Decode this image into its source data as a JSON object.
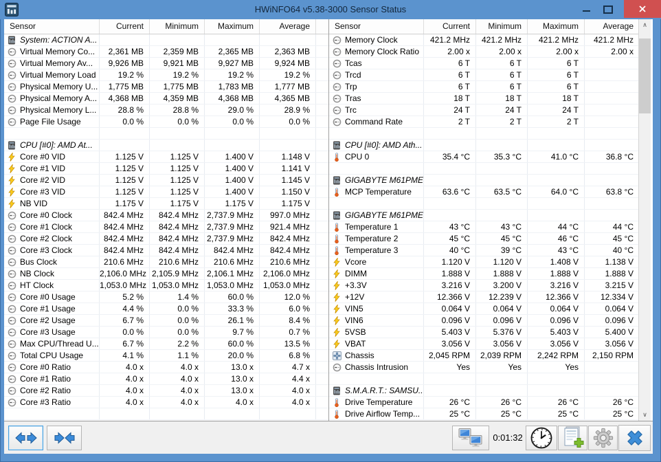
{
  "window": {
    "title": "HWiNFO64 v5.38-3000 Sensor Status",
    "app_icon": "hwinfo-logo-icon",
    "controls": [
      "minimize",
      "maximize",
      "close"
    ]
  },
  "colors": {
    "titlebar_blue": "#5b93ce",
    "close_button_red": "#d05050",
    "toolbar_arrow_blue": "#3c8bd9",
    "bolt_yellow": "#ffd21e",
    "thermometer_orange": "#e85f1e",
    "plus_green": "#7dbd2e"
  },
  "table": {
    "columns": [
      "Sensor",
      "Current",
      "Minimum",
      "Maximum",
      "Average"
    ],
    "left_rows": [
      {
        "type": "section",
        "icon": "chip-icon",
        "label": "System: ACTION A..."
      },
      {
        "type": "sensor",
        "icon": "gauge-icon",
        "label": "Virtual Memory Co...",
        "values": [
          "2,361 MB",
          "2,359 MB",
          "2,365 MB",
          "2,363 MB"
        ]
      },
      {
        "type": "sensor",
        "icon": "gauge-icon",
        "label": "Virtual Memory Av...",
        "values": [
          "9,926 MB",
          "9,921 MB",
          "9,927 MB",
          "9,924 MB"
        ]
      },
      {
        "type": "sensor",
        "icon": "gauge-icon",
        "label": "Virtual Memory Load",
        "values": [
          "19.2 %",
          "19.2 %",
          "19.2 %",
          "19.2 %"
        ]
      },
      {
        "type": "sensor",
        "icon": "gauge-icon",
        "label": "Physical Memory U...",
        "values": [
          "1,775 MB",
          "1,775 MB",
          "1,783 MB",
          "1,777 MB"
        ]
      },
      {
        "type": "sensor",
        "icon": "gauge-icon",
        "label": "Physical Memory A...",
        "values": [
          "4,368 MB",
          "4,359 MB",
          "4,368 MB",
          "4,365 MB"
        ]
      },
      {
        "type": "sensor",
        "icon": "gauge-icon",
        "label": "Physical Memory L...",
        "values": [
          "28.8 %",
          "28.8 %",
          "29.0 %",
          "28.9 %"
        ]
      },
      {
        "type": "sensor",
        "icon": "gauge-icon",
        "label": "Page File Usage",
        "values": [
          "0.0 %",
          "0.0 %",
          "0.0 %",
          "0.0 %"
        ]
      },
      {
        "type": "empty"
      },
      {
        "type": "section",
        "icon": "chip-icon",
        "label": "CPU [#0]: AMD At..."
      },
      {
        "type": "sensor",
        "icon": "bolt-icon",
        "label": "Core #0 VID",
        "values": [
          "1.125 V",
          "1.125 V",
          "1.400 V",
          "1.148 V"
        ]
      },
      {
        "type": "sensor",
        "icon": "bolt-icon",
        "label": "Core #1 VID",
        "values": [
          "1.125 V",
          "1.125 V",
          "1.400 V",
          "1.141 V"
        ]
      },
      {
        "type": "sensor",
        "icon": "bolt-icon",
        "label": "Core #2 VID",
        "values": [
          "1.125 V",
          "1.125 V",
          "1.400 V",
          "1.145 V"
        ]
      },
      {
        "type": "sensor",
        "icon": "bolt-icon",
        "label": "Core #3 VID",
        "values": [
          "1.125 V",
          "1.125 V",
          "1.400 V",
          "1.150 V"
        ]
      },
      {
        "type": "sensor",
        "icon": "bolt-icon",
        "label": "NB VID",
        "values": [
          "1.175 V",
          "1.175 V",
          "1.175 V",
          "1.175 V"
        ]
      },
      {
        "type": "sensor",
        "icon": "gauge-icon",
        "label": "Core #0 Clock",
        "values": [
          "842.4 MHz",
          "842.4 MHz",
          "2,737.9 MHz",
          "997.0 MHz"
        ]
      },
      {
        "type": "sensor",
        "icon": "gauge-icon",
        "label": "Core #1 Clock",
        "values": [
          "842.4 MHz",
          "842.4 MHz",
          "2,737.9 MHz",
          "921.4 MHz"
        ]
      },
      {
        "type": "sensor",
        "icon": "gauge-icon",
        "label": "Core #2 Clock",
        "values": [
          "842.4 MHz",
          "842.4 MHz",
          "2,737.9 MHz",
          "842.4 MHz"
        ]
      },
      {
        "type": "sensor",
        "icon": "gauge-icon",
        "label": "Core #3 Clock",
        "values": [
          "842.4 MHz",
          "842.4 MHz",
          "842.4 MHz",
          "842.4 MHz"
        ]
      },
      {
        "type": "sensor",
        "icon": "gauge-icon",
        "label": "Bus Clock",
        "values": [
          "210.6 MHz",
          "210.6 MHz",
          "210.6 MHz",
          "210.6 MHz"
        ]
      },
      {
        "type": "sensor",
        "icon": "gauge-icon",
        "label": "NB Clock",
        "values": [
          "2,106.0 MHz",
          "2,105.9 MHz",
          "2,106.1 MHz",
          "2,106.0 MHz"
        ]
      },
      {
        "type": "sensor",
        "icon": "gauge-icon",
        "label": "HT Clock",
        "values": [
          "1,053.0 MHz",
          "1,053.0 MHz",
          "1,053.0 MHz",
          "1,053.0 MHz"
        ]
      },
      {
        "type": "sensor",
        "icon": "gauge-icon",
        "label": "Core #0 Usage",
        "values": [
          "5.2 %",
          "1.4 %",
          "60.0 %",
          "12.0 %"
        ]
      },
      {
        "type": "sensor",
        "icon": "gauge-icon",
        "label": "Core #1 Usage",
        "values": [
          "4.4 %",
          "0.0 %",
          "33.3 %",
          "6.0 %"
        ]
      },
      {
        "type": "sensor",
        "icon": "gauge-icon",
        "label": "Core #2 Usage",
        "values": [
          "6.7 %",
          "0.0 %",
          "26.1 %",
          "8.4 %"
        ]
      },
      {
        "type": "sensor",
        "icon": "gauge-icon",
        "label": "Core #3 Usage",
        "values": [
          "0.0 %",
          "0.0 %",
          "9.7 %",
          "0.7 %"
        ]
      },
      {
        "type": "sensor",
        "icon": "gauge-icon",
        "label": "Max CPU/Thread U...",
        "values": [
          "6.7 %",
          "2.2 %",
          "60.0 %",
          "13.5 %"
        ]
      },
      {
        "type": "sensor",
        "icon": "gauge-icon",
        "label": "Total CPU Usage",
        "values": [
          "4.1 %",
          "1.1 %",
          "20.0 %",
          "6.8 %"
        ]
      },
      {
        "type": "sensor",
        "icon": "gauge-icon",
        "label": "Core #0 Ratio",
        "values": [
          "4.0 x",
          "4.0 x",
          "13.0 x",
          "4.7 x"
        ]
      },
      {
        "type": "sensor",
        "icon": "gauge-icon",
        "label": "Core #1 Ratio",
        "values": [
          "4.0 x",
          "4.0 x",
          "13.0 x",
          "4.4 x"
        ]
      },
      {
        "type": "sensor",
        "icon": "gauge-icon",
        "label": "Core #2 Ratio",
        "values": [
          "4.0 x",
          "4.0 x",
          "13.0 x",
          "4.0 x"
        ]
      },
      {
        "type": "sensor",
        "icon": "gauge-icon",
        "label": "Core #3 Ratio",
        "values": [
          "4.0 x",
          "4.0 x",
          "4.0 x",
          "4.0 x"
        ]
      },
      {
        "type": "empty"
      }
    ],
    "right_rows": [
      {
        "type": "sensor",
        "icon": "gauge-icon",
        "label": "Memory Clock",
        "values": [
          "421.2 MHz",
          "421.2 MHz",
          "421.2 MHz",
          "421.2 MHz"
        ]
      },
      {
        "type": "sensor",
        "icon": "gauge-icon",
        "label": "Memory Clock Ratio",
        "values": [
          "2.00 x",
          "2.00 x",
          "2.00 x",
          "2.00 x"
        ]
      },
      {
        "type": "sensor",
        "icon": "gauge-icon",
        "label": "Tcas",
        "values": [
          "6 T",
          "6 T",
          "6 T",
          ""
        ]
      },
      {
        "type": "sensor",
        "icon": "gauge-icon",
        "label": "Trcd",
        "values": [
          "6 T",
          "6 T",
          "6 T",
          ""
        ]
      },
      {
        "type": "sensor",
        "icon": "gauge-icon",
        "label": "Trp",
        "values": [
          "6 T",
          "6 T",
          "6 T",
          ""
        ]
      },
      {
        "type": "sensor",
        "icon": "gauge-icon",
        "label": "Tras",
        "values": [
          "18 T",
          "18 T",
          "18 T",
          ""
        ]
      },
      {
        "type": "sensor",
        "icon": "gauge-icon",
        "label": "Trc",
        "values": [
          "24 T",
          "24 T",
          "24 T",
          ""
        ]
      },
      {
        "type": "sensor",
        "icon": "gauge-icon",
        "label": "Command Rate",
        "values": [
          "2 T",
          "2 T",
          "2 T",
          ""
        ]
      },
      {
        "type": "empty"
      },
      {
        "type": "section",
        "icon": "chip-icon",
        "label": "CPU [#0]: AMD Ath..."
      },
      {
        "type": "sensor",
        "icon": "thermometer-icon",
        "label": "CPU 0",
        "values": [
          "35.4 °C",
          "35.3 °C",
          "41.0 °C",
          "36.8 °C"
        ]
      },
      {
        "type": "empty"
      },
      {
        "type": "section",
        "icon": "chip-icon",
        "label": "GIGABYTE M61PME..."
      },
      {
        "type": "sensor",
        "icon": "thermometer-icon",
        "label": "MCP Temperature",
        "values": [
          "63.6 °C",
          "63.5 °C",
          "64.0 °C",
          "63.8 °C"
        ]
      },
      {
        "type": "empty"
      },
      {
        "type": "section",
        "icon": "chip-icon",
        "label": "GIGABYTE M61PME..."
      },
      {
        "type": "sensor",
        "icon": "thermometer-icon",
        "label": "Temperature 1",
        "values": [
          "43 °C",
          "43 °C",
          "44 °C",
          "44 °C"
        ]
      },
      {
        "type": "sensor",
        "icon": "thermometer-icon",
        "label": "Temperature 2",
        "values": [
          "45 °C",
          "45 °C",
          "46 °C",
          "45 °C"
        ]
      },
      {
        "type": "sensor",
        "icon": "thermometer-icon",
        "label": "Temperature 3",
        "values": [
          "40 °C",
          "39 °C",
          "43 °C",
          "40 °C"
        ]
      },
      {
        "type": "sensor",
        "icon": "bolt-icon",
        "label": "Vcore",
        "values": [
          "1.120 V",
          "1.120 V",
          "1.408 V",
          "1.138 V"
        ]
      },
      {
        "type": "sensor",
        "icon": "bolt-icon",
        "label": "DIMM",
        "values": [
          "1.888 V",
          "1.888 V",
          "1.888 V",
          "1.888 V"
        ]
      },
      {
        "type": "sensor",
        "icon": "bolt-icon",
        "label": "+3.3V",
        "values": [
          "3.216 V",
          "3.200 V",
          "3.216 V",
          "3.215 V"
        ]
      },
      {
        "type": "sensor",
        "icon": "bolt-icon",
        "label": "+12V",
        "values": [
          "12.366 V",
          "12.239 V",
          "12.366 V",
          "12.334 V"
        ]
      },
      {
        "type": "sensor",
        "icon": "bolt-icon",
        "label": "VIN5",
        "values": [
          "0.064 V",
          "0.064 V",
          "0.064 V",
          "0.064 V"
        ]
      },
      {
        "type": "sensor",
        "icon": "bolt-icon",
        "label": "VIN6",
        "values": [
          "0.096 V",
          "0.096 V",
          "0.096 V",
          "0.096 V"
        ]
      },
      {
        "type": "sensor",
        "icon": "bolt-icon",
        "label": "5VSB",
        "values": [
          "5.403 V",
          "5.376 V",
          "5.403 V",
          "5.400 V"
        ]
      },
      {
        "type": "sensor",
        "icon": "bolt-icon",
        "label": "VBAT",
        "values": [
          "3.056 V",
          "3.056 V",
          "3.056 V",
          "3.056 V"
        ]
      },
      {
        "type": "sensor",
        "icon": "fan-icon",
        "label": "Chassis",
        "values": [
          "2,045 RPM",
          "2,039 RPM",
          "2,242 RPM",
          "2,150 RPM"
        ]
      },
      {
        "type": "sensor",
        "icon": "gauge-icon",
        "label": "Chassis Intrusion",
        "values": [
          "Yes",
          "Yes",
          "Yes",
          ""
        ]
      },
      {
        "type": "empty"
      },
      {
        "type": "section",
        "icon": "chip-icon",
        "label": "S.M.A.R.T.: SAMSU..."
      },
      {
        "type": "sensor",
        "icon": "thermometer-icon",
        "label": "Drive Temperature",
        "values": [
          "26 °C",
          "26 °C",
          "26 °C",
          "26 °C"
        ]
      },
      {
        "type": "sensor",
        "icon": "thermometer-icon",
        "label": "Drive Airflow Temp...",
        "values": [
          "25 °C",
          "25 °C",
          "25 °C",
          "25 °C"
        ]
      }
    ]
  },
  "toolbar": {
    "elapsed_time": "0:01:32",
    "buttons": [
      "expand-columns",
      "collapse-columns",
      "remote-monitoring",
      "clock",
      "report-log",
      "settings",
      "close"
    ]
  }
}
